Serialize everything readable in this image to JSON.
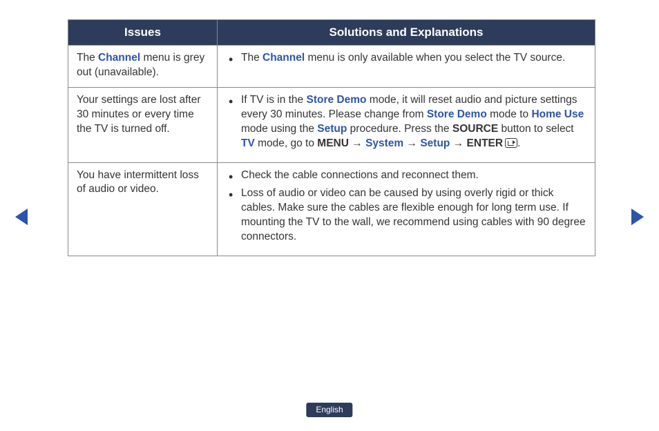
{
  "headers": {
    "issues": "Issues",
    "solutions": "Solutions and Explanations"
  },
  "rows": [
    {
      "issue": {
        "pre": "The ",
        "hl": "Channel",
        "post": " menu is grey out (unavailable)."
      },
      "sol1": {
        "pre": "The ",
        "hl": "Channel",
        "post": " menu is only available when you select the TV source."
      }
    },
    {
      "issue_plain": "Your settings are lost after 30 minutes or every time the TV is turned off.",
      "sol": {
        "t1": "If TV is in the ",
        "hl1": "Store Demo",
        "t2": " mode, it will reset audio and picture settings every 30 minutes. Please change from ",
        "hl2": "Store Demo",
        "t3": " mode to ",
        "hl3": "Home Use",
        "t4": " mode using the ",
        "hl4": "Setup",
        "t5": " procedure. Press the ",
        "b1": "SOURCE",
        "t6": " button to select ",
        "hl5": "TV",
        "t7": " mode, go to ",
        "b2": "MENU",
        "arr1": " → ",
        "hl6": "System",
        "arr2": " → ",
        "hl7": "Setup",
        "arr3": " → ",
        "b3": "ENTER",
        "period": "."
      }
    },
    {
      "issue_plain": "You have intermittent loss of audio or video.",
      "sol1_plain": "Check the cable connections and reconnect them.",
      "sol2_plain": "Loss of audio or video can be caused by using overly rigid or thick cables. Make sure the cables are flexible enough for long term use. If mounting the TV to the wall, we recommend using cables with 90 degree connectors."
    }
  ],
  "language": "English"
}
